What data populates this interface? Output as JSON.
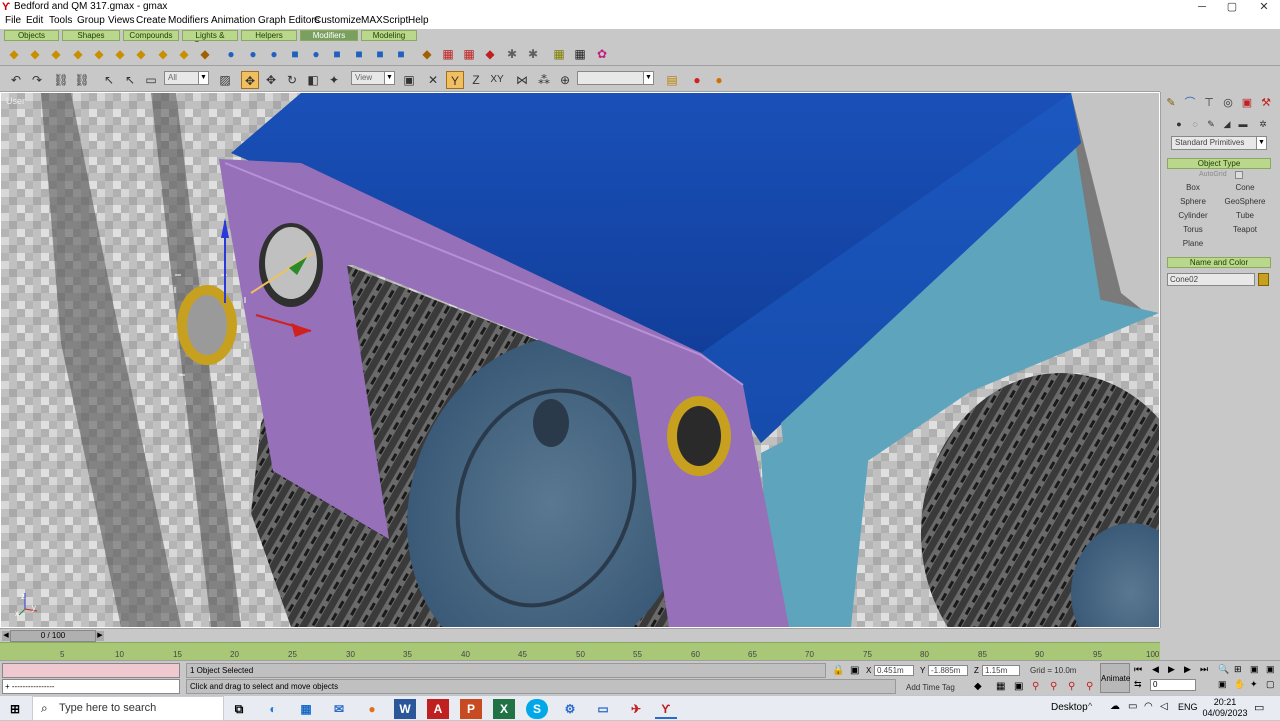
{
  "window": {
    "title": "Bedford and QM 317.gmax - gmax",
    "app_icon": "gmax-logo-icon",
    "controls": [
      "─",
      "▢",
      "✕"
    ]
  },
  "menubar": {
    "items": [
      "File",
      "Edit",
      "Tools",
      "Group",
      "Views",
      "Create",
      "Modifiers",
      "Animation",
      "Graph Editors",
      "Customize",
      "MAXScript",
      "Help"
    ]
  },
  "tabs": {
    "items": [
      "Objects",
      "Shapes",
      "Compounds",
      "Lights & Cameras",
      "Helpers",
      "Modifiers",
      "Modeling"
    ],
    "active": "Modifiers"
  },
  "toolbar": {
    "selection_filter": "All",
    "reference_coord": "View",
    "named_selection": "",
    "axis_labels": {
      "y": "Y",
      "z": "Z",
      "xy": "XY"
    }
  },
  "viewport": {
    "label": "User",
    "axis": {
      "x": "x",
      "y": "y",
      "z": "z"
    }
  },
  "command_panel": {
    "category": "Standard Primitives",
    "object_type": {
      "title": "Object Type",
      "autogrid": "AutoGrid",
      "buttons": [
        "Box",
        "Cone",
        "Sphere",
        "GeoSphere",
        "Cylinder",
        "Tube",
        "Torus",
        "Teapot",
        "Plane"
      ]
    },
    "name_and_color": {
      "title": "Name and Color",
      "name": "Cone02",
      "color": "#c8a020"
    }
  },
  "timeline": {
    "frame": "0 / 100",
    "ticks": [
      "5",
      "10",
      "15",
      "20",
      "25",
      "30",
      "35",
      "40",
      "45",
      "50",
      "55",
      "60",
      "65",
      "70",
      "75",
      "80",
      "85",
      "90",
      "95",
      "100"
    ]
  },
  "status": {
    "script_line": "+ ----------------",
    "selection": "1 Object Selected",
    "prompt": "Click and drag to select and move objects",
    "x_label": "X",
    "x": "0.451m",
    "y_label": "Y",
    "y": "-1.885m",
    "z_label": "Z",
    "z": "1.15m",
    "grid": "Grid = 10.0m",
    "add_time_tag": "Add Time Tag",
    "animate": "Animate",
    "frame_value": "0"
  },
  "taskbar": {
    "search_placeholder": "Type here to search",
    "desktop": "Desktop",
    "lang": "ENG",
    "time": "20:21",
    "date": "04/09/2023"
  },
  "colors": {
    "accent_tab": "#b9d88b",
    "active_tool": "#f0c060",
    "frame_purple": "#9870b8",
    "body_blue": "#1a4aa8",
    "cab_cyan": "#5aa0b8",
    "ring_gold": "#c8a020"
  }
}
